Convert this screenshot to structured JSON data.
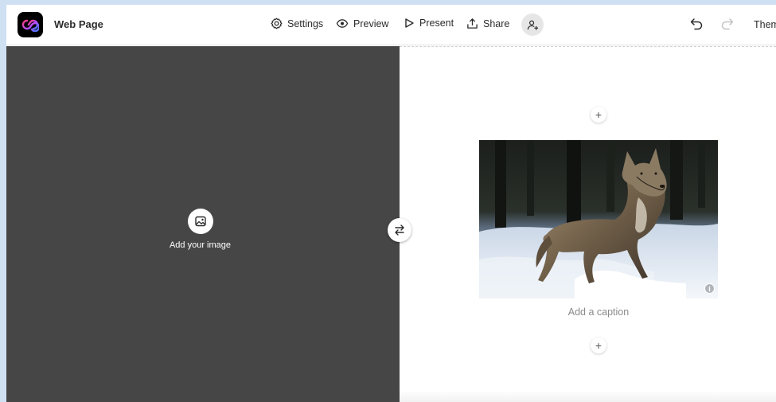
{
  "app": {
    "title": "Web Page"
  },
  "toolbar": {
    "settings_label": "Settings",
    "preview_label": "Preview",
    "present_label": "Present",
    "share_label": "Share",
    "theme_label": "Theme"
  },
  "left_panel": {
    "add_image_label": "Add your image"
  },
  "right_panel": {
    "caption_placeholder": "Add a caption"
  },
  "icons": [
    "app-logo-icon",
    "gear-icon",
    "eye-icon",
    "play-icon",
    "share-icon",
    "add-person-icon",
    "undo-icon",
    "redo-icon",
    "image-icon",
    "swap-icon",
    "plus-icon",
    "info-icon"
  ],
  "colors": {
    "panel_dark": "#464646",
    "frame": "#cfe0f3",
    "logo_bg": "#000000"
  }
}
